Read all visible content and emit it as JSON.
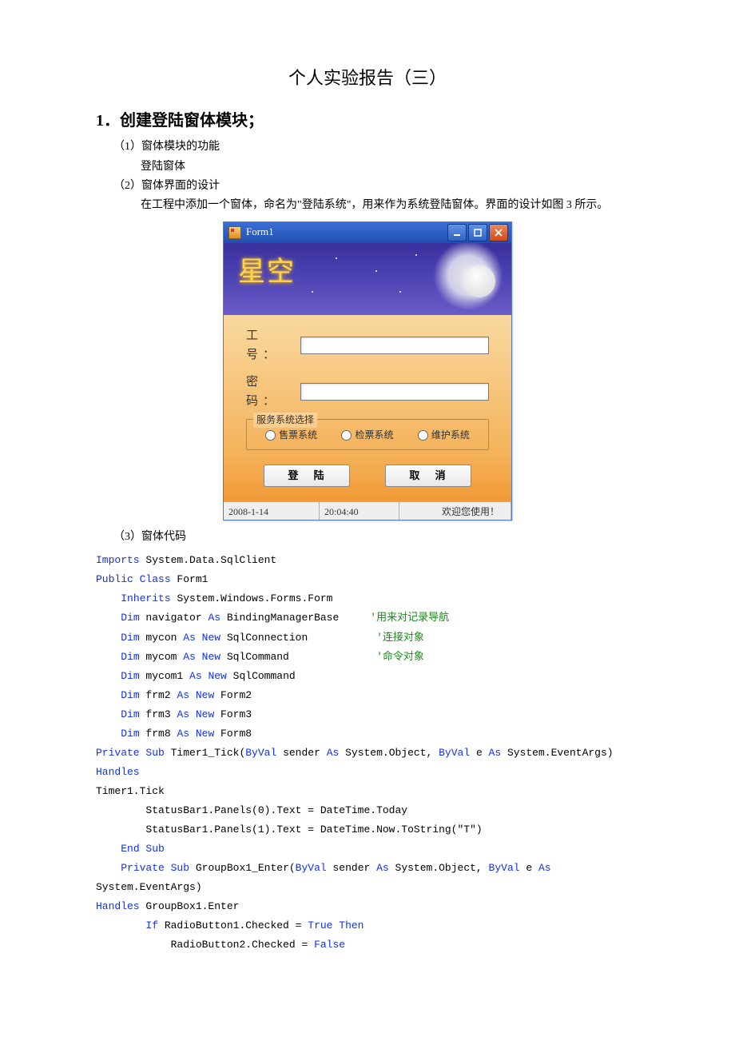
{
  "doc": {
    "title": "个人实验报告（三）",
    "section1": "1．创建登陆窗体模块；",
    "sub1": "（1）窗体模块的功能",
    "sub1body": "登陆窗体",
    "sub2": "（2）窗体界面的设计",
    "sub2body": "在工程中添加一个窗体，命名为\"登陆系统\"，用来作为系统登陆窗体。界面的设计如图 3 所示。",
    "sub3": "（3）窗体代码"
  },
  "form": {
    "title": "Form1",
    "banner_logo": "星空",
    "labels": {
      "gongHao": "工 号：",
      "miMa": "密 码："
    },
    "group_legend": "服务系统选择",
    "radios": {
      "r1": "售票系统",
      "r2": "检票系统",
      "r3": "维护系统"
    },
    "buttons": {
      "login": "登  陆",
      "cancel": "取  消"
    },
    "status": {
      "date": "2008-1-14",
      "time": "20:04:40",
      "welcome": "欢迎您使用！"
    }
  },
  "code": {
    "l01a": "Imports",
    "l01b": " System.Data.SqlClient",
    "l02a": "Public Class",
    "l02b": " Form1",
    "l03a": "    Inherits",
    "l03b": " System.Windows.Forms.Form",
    "l04a": "    Dim",
    "l04b": " navigator ",
    "l04c": "As",
    "l04d": " BindingManagerBase     ",
    "l04e": "'用来对记录导航",
    "l05a": "    Dim",
    "l05b": " mycon ",
    "l05c": "As New",
    "l05d": " SqlConnection           ",
    "l05e": "'连接对象",
    "l06a": "    Dim",
    "l06b": " mycom ",
    "l06c": "As New",
    "l06d": " SqlCommand              ",
    "l06e": "'命令对象",
    "l07a": "    Dim",
    "l07b": " mycom1 ",
    "l07c": "As New",
    "l07d": " SqlCommand",
    "l08a": "    Dim",
    "l08b": " frm2 ",
    "l08c": "As New",
    "l08d": " Form2",
    "l09a": "    Dim",
    "l09b": " frm3 ",
    "l09c": "As New",
    "l09d": " Form3",
    "l10a": "    Dim",
    "l10b": " frm8 ",
    "l10c": "As New",
    "l10d": " Form8",
    "l11a": "Private Sub",
    "l11b": " Timer1_Tick(",
    "l11c": "ByVal",
    "l11d": " sender ",
    "l11e": "As",
    "l11f": " System.Object, ",
    "l11g": "ByVal",
    "l11h": " e ",
    "l11i": "As",
    "l11j": " System.EventArgs) ",
    "l11k": "Handles",
    "l12": "Timer1.Tick",
    "l13": "        StatusBar1.Panels(0).Text = DateTime.Today",
    "l14": "        StatusBar1.Panels(1).Text = DateTime.Now.ToString(\"T\")",
    "l15": "    End Sub",
    "l16a": "    Private Sub",
    "l16b": " GroupBox1_Enter(",
    "l16c": "ByVal",
    "l16d": " sender ",
    "l16e": "As",
    "l16f": " System.Object, ",
    "l16g": "ByVal",
    "l16h": " e ",
    "l16i": "As",
    "l16j": " System.EventArgs)",
    "l17a": "Handles",
    "l17b": " GroupBox1.Enter",
    "l18a": "        If",
    "l18b": " RadioButton1.Checked = ",
    "l18c": "True Then",
    "l19a": "            RadioButton2.Checked = ",
    "l19b": "False"
  }
}
